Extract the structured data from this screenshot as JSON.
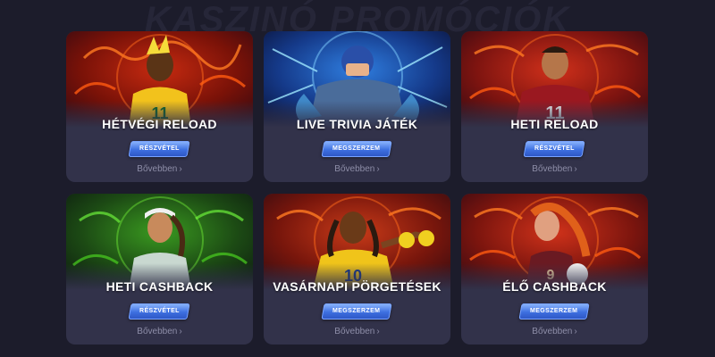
{
  "page": {
    "heading": "KASZINÓ PROMÓCIÓK"
  },
  "cards": [
    {
      "title": "HÉTVÉGI RELOAD",
      "button": "RÉSZVÉTEL",
      "more": "Bővebben",
      "chevron": "›",
      "theme": "red",
      "figure": "11"
    },
    {
      "title": "LIVE TRIVIA JÁTÉK",
      "button": "MEGSZERZEM",
      "more": "Bővebben",
      "chevron": "›",
      "theme": "blue",
      "figure": ""
    },
    {
      "title": "HETI RELOAD",
      "button": "RÉSZVÉTEL",
      "more": "Bővebben",
      "chevron": "›",
      "theme": "red",
      "figure": "11"
    },
    {
      "title": "HETI CASHBACK",
      "button": "RÉSZVÉTEL",
      "more": "Bővebben",
      "chevron": "›",
      "theme": "green",
      "figure": ""
    },
    {
      "title": "VASÁRNAPI PÖRGETÉSEK",
      "button": "MEGSZERZEM",
      "more": "Bővebben",
      "chevron": "›",
      "theme": "red",
      "figure": "10"
    },
    {
      "title": "ÉLŐ CASHBACK",
      "button": "MEGSZERZEM",
      "more": "Bővebben",
      "chevron": "›",
      "theme": "red",
      "figure": "9"
    }
  ],
  "colors": {
    "background": "#1c1c2b",
    "card": "#32324a",
    "button": "#3d6fe0",
    "link": "#8e8ea8"
  }
}
